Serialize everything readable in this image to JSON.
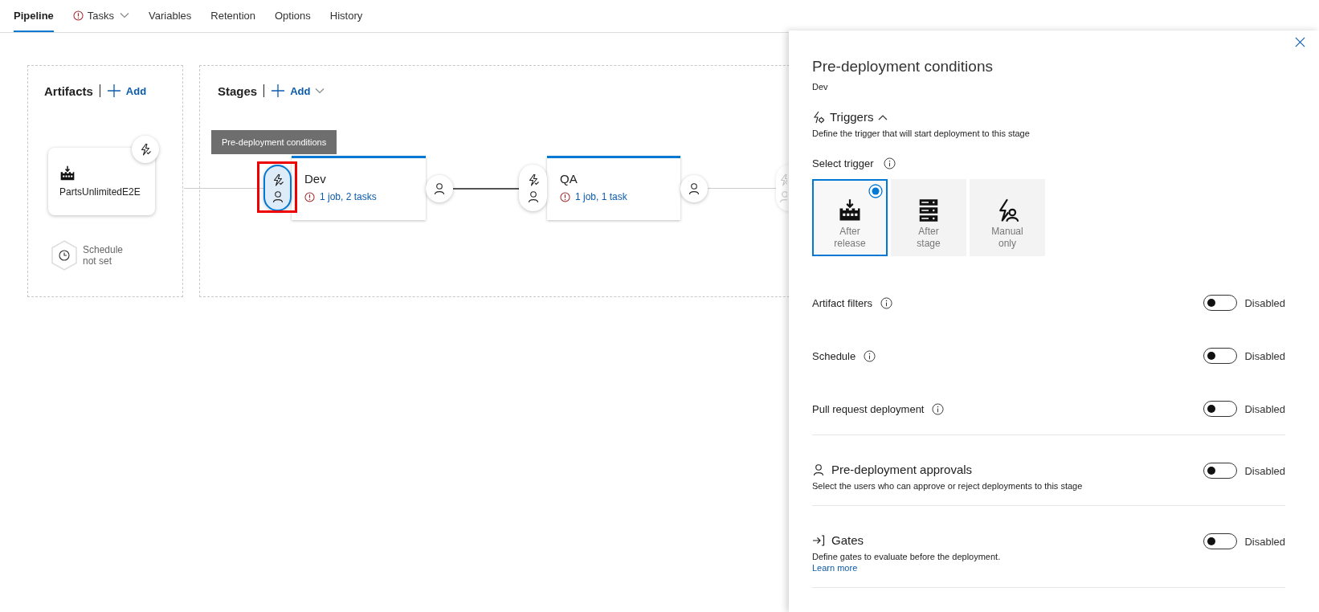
{
  "tabs": [
    {
      "label": "Pipeline",
      "selected": true,
      "warning": false,
      "dropdown": false
    },
    {
      "label": "Tasks",
      "selected": false,
      "warning": true,
      "dropdown": true
    },
    {
      "label": "Variables",
      "selected": false,
      "warning": false,
      "dropdown": false
    },
    {
      "label": "Retention",
      "selected": false,
      "warning": false,
      "dropdown": false
    },
    {
      "label": "Options",
      "selected": false,
      "warning": false,
      "dropdown": false
    },
    {
      "label": "History",
      "selected": false,
      "warning": false,
      "dropdown": false
    }
  ],
  "artifacts": {
    "title": "Artifacts",
    "add_label": "Add",
    "items": [
      {
        "name": "PartsUnlimitedE2E"
      }
    ],
    "schedule": "Schedule not set"
  },
  "stages": {
    "title": "Stages",
    "add_label": "Add",
    "tooltip": "Pre-deployment conditions",
    "items": [
      {
        "kind": "card",
        "name": "Dev",
        "summary": "1 job, 2 tasks",
        "highlighted": true
      },
      {
        "kind": "card",
        "name": "QA",
        "summary": "1 job, 1 task",
        "highlighted": false
      },
      {
        "kind": "covered"
      }
    ]
  },
  "panel": {
    "title": "Pre-deployment conditions",
    "subtitle": "Dev",
    "triggers": {
      "title": "Triggers",
      "expanded": true,
      "description": "Define the trigger that will start deployment to this stage",
      "select_label": "Select trigger",
      "options": [
        {
          "kind": "release",
          "label": "After release",
          "selected": true
        },
        {
          "kind": "stage",
          "label": "After stage",
          "selected": false
        },
        {
          "kind": "manual",
          "label": "Manual only",
          "selected": false
        }
      ]
    },
    "rows": [
      {
        "kind": "setting",
        "label": "Artifact filters",
        "on": false,
        "status": "Disabled"
      },
      {
        "kind": "setting",
        "label": "Schedule",
        "on": false,
        "status": "Disabled"
      },
      {
        "kind": "setting",
        "label": "Pull request deployment",
        "on": false,
        "status": "Disabled"
      },
      {
        "kind": "approvals",
        "label": "Pre-deployment approvals",
        "description": "Select the users who can approve or reject deployments to this stage",
        "on": false,
        "status": "Disabled"
      },
      {
        "kind": "gates",
        "label": "Gates",
        "description": "Define gates to evaluate before the deployment.",
        "link": "Learn more",
        "on": false,
        "status": "Disabled"
      }
    ]
  }
}
